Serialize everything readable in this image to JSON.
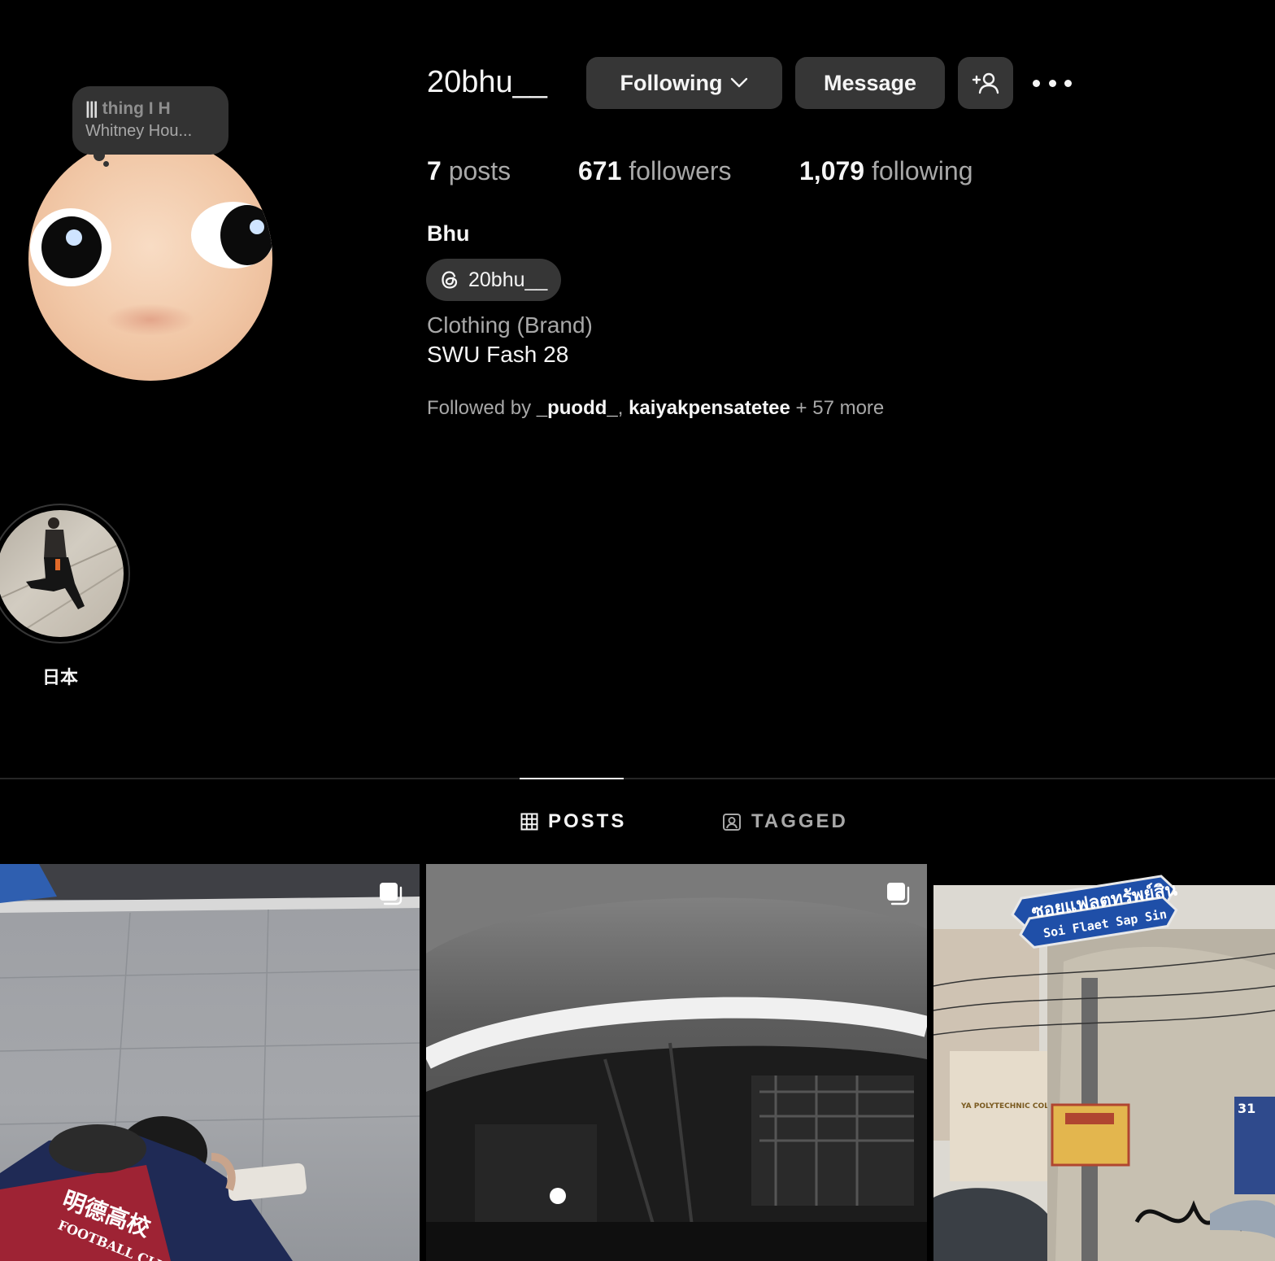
{
  "note": {
    "line1": "thing  I H",
    "line2": "Whitney Hou..."
  },
  "profile": {
    "username": "20bhu__",
    "full_name": "Bhu",
    "threads_handle": "20bhu__",
    "category": "Clothing (Brand)",
    "bio": "SWU Fash 28",
    "followed_by_prefix": "Followed by ",
    "followed_by_user1": "_puodd_",
    "followed_by_sep": ", ",
    "followed_by_user2": "kaiyakpensatetee",
    "followed_by_suffix": " + 57 more"
  },
  "actions": {
    "following_label": "Following",
    "message_label": "Message"
  },
  "stats": {
    "posts_count": "7",
    "posts_label": "posts",
    "followers_count": "671",
    "followers_label": "followers",
    "following_count": "1,079",
    "following_label": "following"
  },
  "highlights": [
    {
      "label": "日本"
    }
  ],
  "tabs": {
    "posts": "POSTS",
    "tagged": "TAGGED",
    "active": "posts"
  },
  "posts": [
    {
      "type": "carousel",
      "shirt_text_1": "明德高校",
      "shirt_text_2": "FOOTBALL CLUB"
    },
    {
      "type": "carousel"
    },
    {
      "type": "single",
      "sign_thai": "ซอยแฟลตทรัพย์สิน",
      "sign_en": "Soi Flaet Sap Sin",
      "building_text": "YA POLYTECHNIC COLLEGE",
      "badge_number": "31"
    }
  ],
  "icons": [
    "threads-icon",
    "chevron-down-icon",
    "add-user-icon",
    "more-icon",
    "grid-icon",
    "tagged-icon",
    "carousel-icon"
  ],
  "colors": {
    "background": "#000000",
    "button_bg": "#363636",
    "secondary_text": "#a8a8a8",
    "primary_text": "#f5f5f5"
  }
}
